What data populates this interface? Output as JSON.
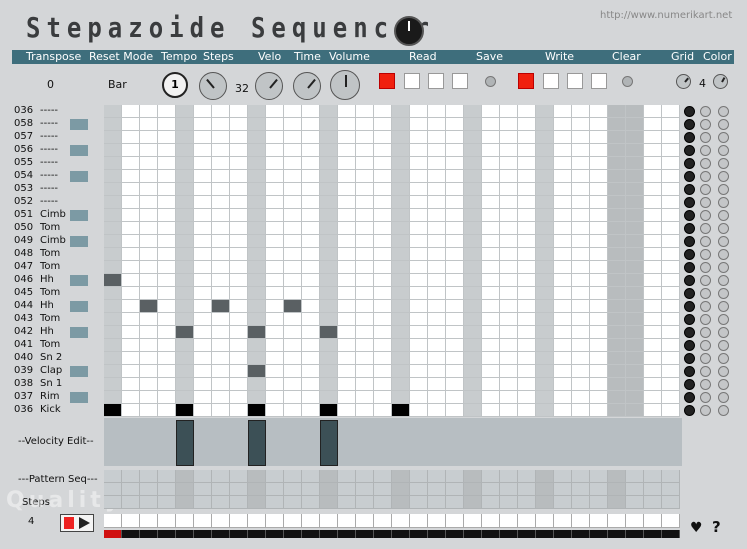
{
  "app": {
    "title": "Stepazoide Sequencer",
    "url": "http://www.numerikart.net",
    "watermark": "Quality"
  },
  "header": [
    "Transpose",
    "Reset Mode",
    "Tempo",
    "Steps",
    "Velo",
    "Time",
    "Volume",
    "Read",
    "Save",
    "Write",
    "Clear",
    "Grid",
    "Color"
  ],
  "controls": {
    "transpose": "0",
    "reset_mode": "Bar",
    "tempo_value": "1",
    "steps_value": "32",
    "grid_value": "4"
  },
  "rows": [
    {
      "note": "036",
      "name": "-----"
    },
    {
      "note": "058",
      "name": "-----"
    },
    {
      "note": "057",
      "name": "-----"
    },
    {
      "note": "056",
      "name": "-----"
    },
    {
      "note": "055",
      "name": "-----"
    },
    {
      "note": "054",
      "name": "-----"
    },
    {
      "note": "053",
      "name": "-----"
    },
    {
      "note": "052",
      "name": "-----"
    },
    {
      "note": "051",
      "name": "Cimb"
    },
    {
      "note": "050",
      "name": "Tom"
    },
    {
      "note": "049",
      "name": "Cimb"
    },
    {
      "note": "048",
      "name": "Tom"
    },
    {
      "note": "047",
      "name": "Tom"
    },
    {
      "note": "046",
      "name": "Hh"
    },
    {
      "note": "045",
      "name": "Tom"
    },
    {
      "note": "044",
      "name": "Hh"
    },
    {
      "note": "043",
      "name": "Tom"
    },
    {
      "note": "042",
      "name": "Hh"
    },
    {
      "note": "041",
      "name": "Tom"
    },
    {
      "note": "040",
      "name": "Sn 2"
    },
    {
      "note": "039",
      "name": "Clap"
    },
    {
      "note": "038",
      "name": "Sn 1"
    },
    {
      "note": "037",
      "name": "Rim"
    },
    {
      "note": "036",
      "name": "Kick"
    }
  ],
  "active_rows": [
    1,
    3,
    5,
    8,
    10,
    13,
    15,
    17,
    20,
    22
  ],
  "notes": [
    {
      "row": 13,
      "step": 0,
      "level": "dark"
    },
    {
      "row": 15,
      "step": 2,
      "level": "dark"
    },
    {
      "row": 15,
      "step": 6,
      "level": "dark"
    },
    {
      "row": 15,
      "step": 10,
      "level": "dark"
    },
    {
      "row": 17,
      "step": 4,
      "level": "dark"
    },
    {
      "row": 17,
      "step": 8,
      "level": "dark"
    },
    {
      "row": 17,
      "step": 12,
      "level": "dark"
    },
    {
      "row": 20,
      "step": 8,
      "level": "dark"
    },
    {
      "row": 23,
      "step": 0,
      "level": "black"
    },
    {
      "row": 23,
      "step": 4,
      "level": "black"
    },
    {
      "row": 23,
      "step": 8,
      "level": "black"
    },
    {
      "row": 23,
      "step": 12,
      "level": "black"
    },
    {
      "row": 23,
      "step": 16,
      "level": "black"
    }
  ],
  "velocity_steps": [
    4,
    8,
    12
  ],
  "panels": {
    "velocity_label": "--Velocity Edit--",
    "pattern_label": "---Pattern Seq---",
    "steps_label": "Steps",
    "steps_value": "4"
  }
}
